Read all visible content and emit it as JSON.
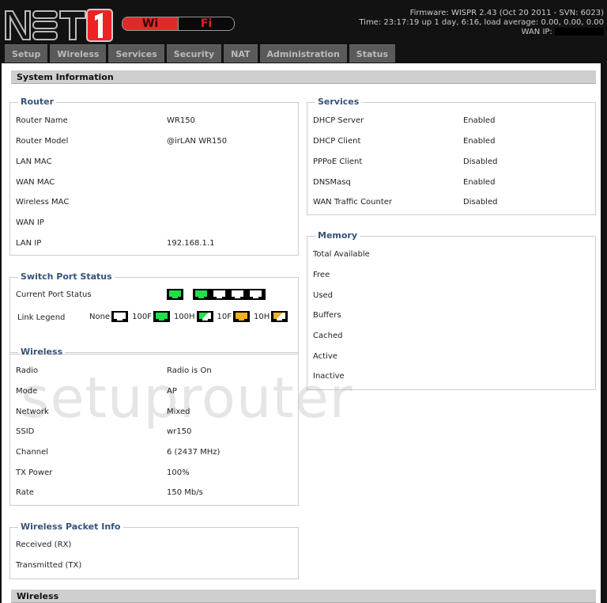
{
  "header": {
    "logo_text": "NET",
    "logo_number": "1",
    "wifi_left": "Wi",
    "wifi_right": "Fi",
    "firmware": "Firmware: WISPR 2.43 (Oct 20 2011 - SVN: 6023)",
    "time": "Time: 23:17:19 up 1 day, 6:16, load average: 0.00, 0.00, 0.00",
    "wan_ip_label": "WAN IP:"
  },
  "tabs": [
    "Setup",
    "Wireless",
    "Services",
    "Security",
    "NAT",
    "Administration",
    "Status"
  ],
  "sections": {
    "system_information": "System Information",
    "wireless_bottom": "Wireless"
  },
  "router": {
    "legend": "Router",
    "rows": [
      {
        "label": "Router Name",
        "value": "WR150"
      },
      {
        "label": "Router Model",
        "value": "@irLAN WR150"
      },
      {
        "label": "LAN MAC",
        "value": ""
      },
      {
        "label": "WAN MAC",
        "value": ""
      },
      {
        "label": "Wireless MAC",
        "value": ""
      },
      {
        "label": "WAN IP",
        "value": ""
      },
      {
        "label": "LAN IP",
        "value": "192.168.1.1"
      }
    ]
  },
  "services": {
    "legend": "Services",
    "rows": [
      {
        "label": "DHCP Server",
        "value": "Enabled"
      },
      {
        "label": "DHCP Client",
        "value": "Enabled"
      },
      {
        "label": "PPPoE Client",
        "value": "Disabled"
      },
      {
        "label": "DNSMasq",
        "value": "Enabled"
      },
      {
        "label": "WAN Traffic Counter",
        "value": "Disabled"
      }
    ]
  },
  "memory": {
    "legend": "Memory",
    "rows": [
      {
        "label": "Total Available",
        "value": ""
      },
      {
        "label": "Free",
        "value": ""
      },
      {
        "label": "Used",
        "value": ""
      },
      {
        "label": "Buffers",
        "value": ""
      },
      {
        "label": "Cached",
        "value": ""
      },
      {
        "label": "Active",
        "value": ""
      },
      {
        "label": "Inactive",
        "value": ""
      }
    ]
  },
  "switch": {
    "legend": "Switch Port Status",
    "current_label": "Current Port Status",
    "ports": [
      "100F",
      "100F",
      "None",
      "None",
      "None"
    ],
    "legend_label": "Link Legend",
    "legend_items": [
      "None",
      "100F",
      "100H",
      "10F",
      "10H"
    ]
  },
  "wireless": {
    "legend": "Wireless",
    "rows": [
      {
        "label": "Radio",
        "value": "Radio is On"
      },
      {
        "label": "Mode",
        "value": "AP"
      },
      {
        "label": "Network",
        "value": "Mixed"
      },
      {
        "label": "SSID",
        "value": "wr150"
      },
      {
        "label": "Channel",
        "value": "6 (2437 MHz)"
      },
      {
        "label": "TX Power",
        "value": "100%"
      },
      {
        "label": "Rate",
        "value": "150 Mb/s"
      }
    ]
  },
  "packet_info": {
    "legend": "Wireless Packet Info",
    "rows": [
      {
        "label": "Received (RX)",
        "value": ""
      },
      {
        "label": "Transmitted (TX)",
        "value": ""
      }
    ]
  },
  "watermark": "setuprouter",
  "colors": {
    "green": "#22e04a",
    "orange": "#f0b020",
    "legend_blue": "#36527a",
    "wifi_red": "#e02a2a"
  }
}
